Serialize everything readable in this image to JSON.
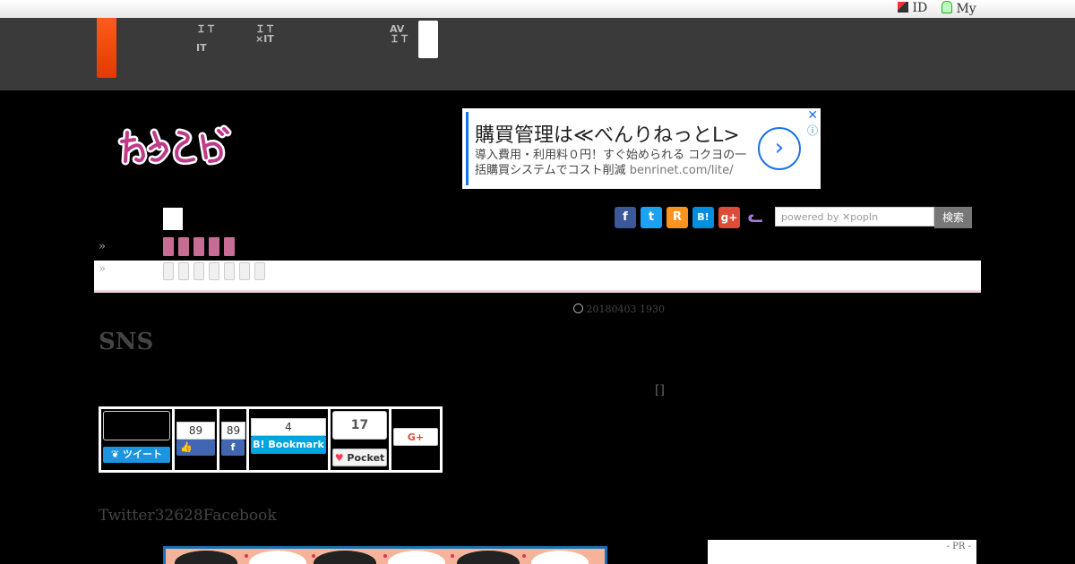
{
  "topbar": {
    "id_label": "ID",
    "my_label": "My"
  },
  "nav": {
    "item1_line1": "ＩＴ",
    "item1_line2": "IT",
    "item2_line1": "ＩＴ",
    "item2_line2": "×IT",
    "item3_line1": "AV",
    "item3_line2": "ＩＴ"
  },
  "ad": {
    "headline": "購買管理は≪べんりねっとL>",
    "desc": "導入費用・利用料０円！すぐ始められる コクヨの一括購買システムでコスト削減",
    "url": "benrinet.com/lite/",
    "close": "✕",
    "info": "ⓘ",
    "arrow": "›"
  },
  "breadcrumb": {
    "raquo1": "»",
    "raquo2": "»"
  },
  "social": {
    "facebook": "f",
    "twitter": "t",
    "rss": "R",
    "hatena": "B!",
    "gplus": "g+",
    "cat": "ᓚ"
  },
  "search": {
    "placeholder": "powered by ✕popIn",
    "button": "検索"
  },
  "article": {
    "date": "20180403 1930",
    "title": "SNS",
    "bracket": "[]",
    "subline": "Twitter32628Facebook"
  },
  "share": {
    "tweet_label": "ツイート",
    "like_count": "89",
    "fb_count": "89",
    "bookmark_count": "4",
    "bookmark_label": "Bookmark",
    "pocket_count": "17",
    "pocket_label": "Pocket",
    "gplus_label": "G+"
  },
  "sidebar": {
    "pr_label": "- PR -"
  }
}
